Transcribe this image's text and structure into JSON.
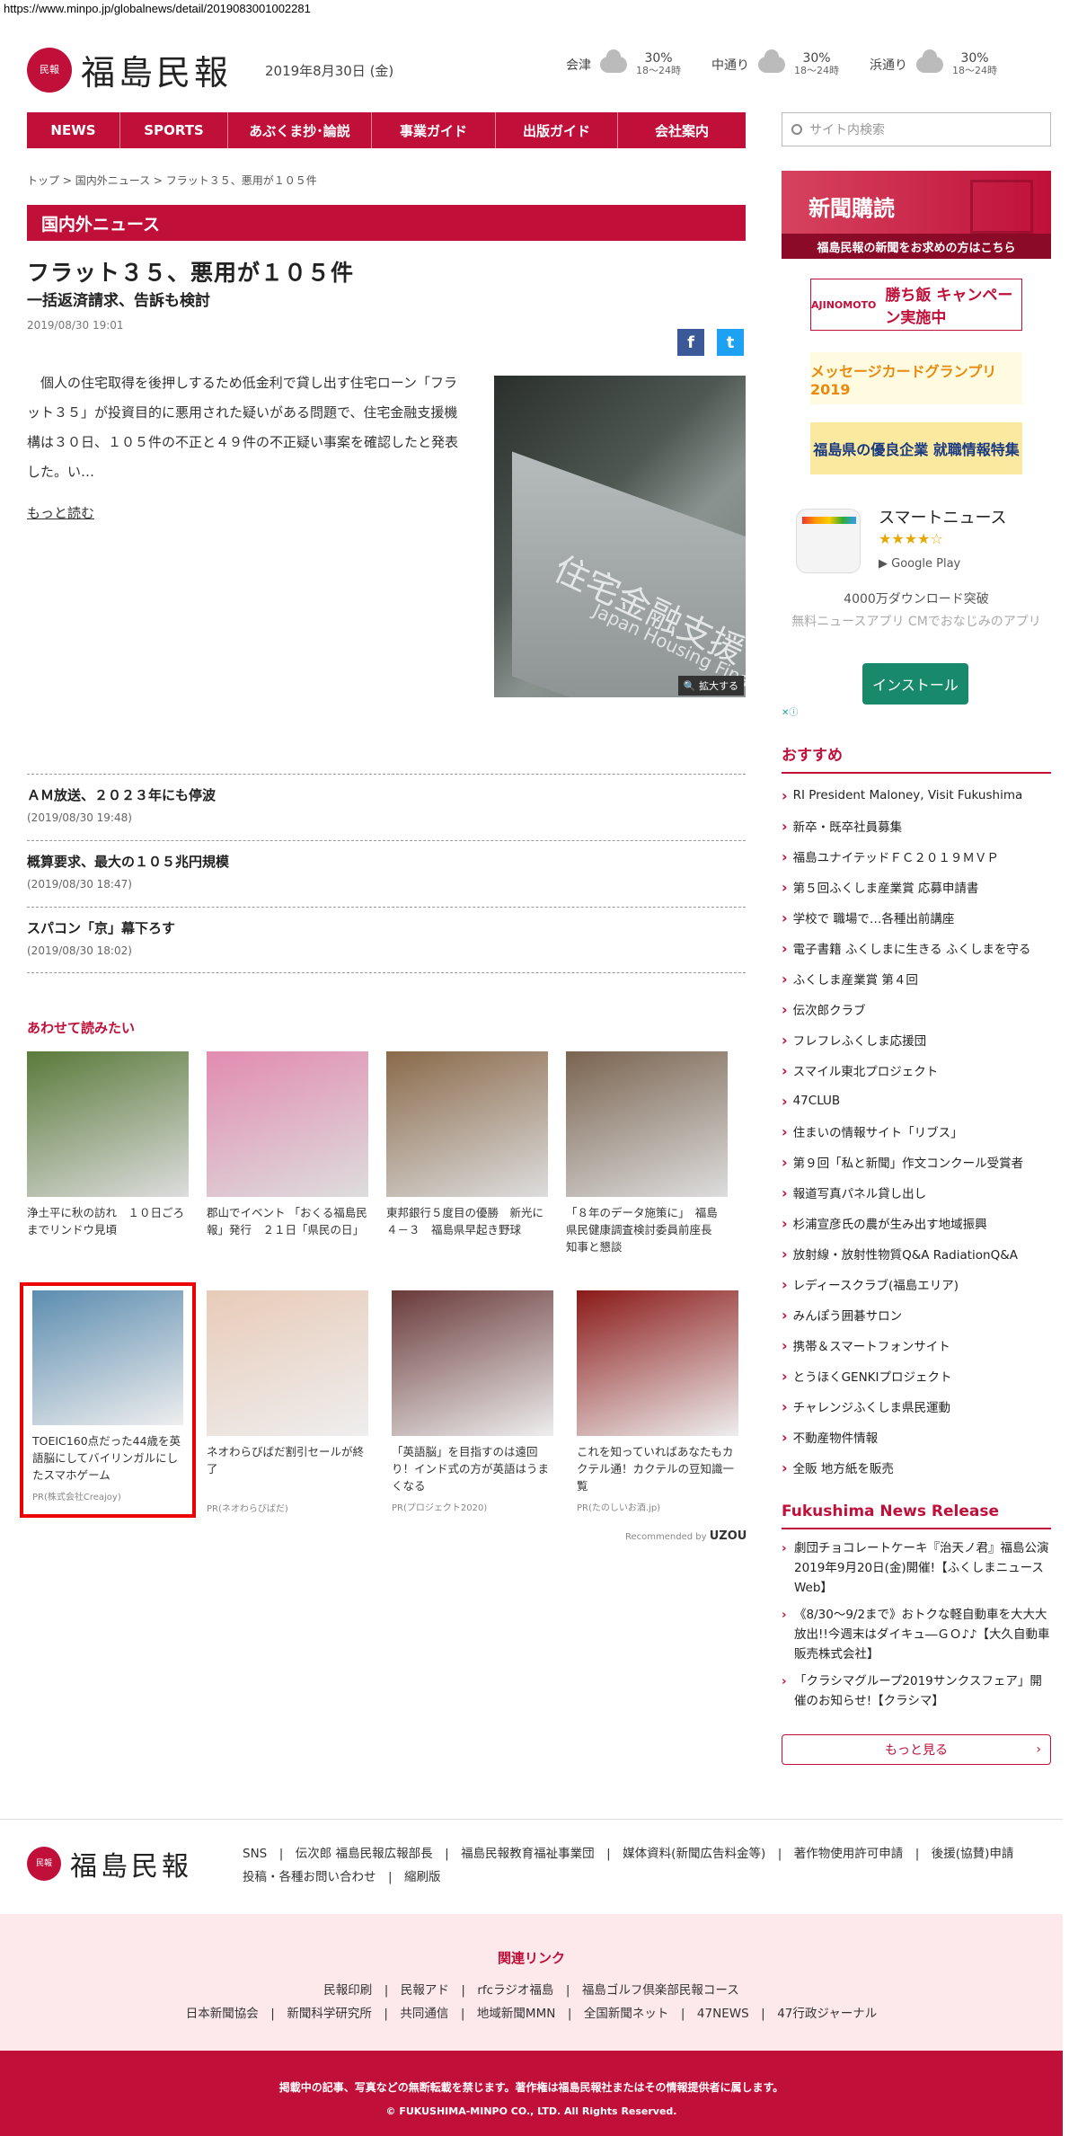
{
  "url": "https://www.minpo.jp/globalnews/detail/2019083001002281",
  "logo": {
    "seal": "民報",
    "name": "福島民報"
  },
  "date": "2019年8月30日 (金)",
  "weather": [
    {
      "area": "会津",
      "pct": "30%",
      "time": "18～24時"
    },
    {
      "area": "中通り",
      "pct": "30%",
      "time": "18～24時"
    },
    {
      "area": "浜通り",
      "pct": "30%",
      "time": "18～24時"
    }
  ],
  "nav": [
    "NEWS",
    "SPORTS",
    "あぶくま抄･論説",
    "事業ガイド",
    "出版ガイド",
    "会社案内"
  ],
  "search_placeholder": "サイト内検索",
  "breadcrumb": [
    "トップ",
    "国内外ニュース",
    "フラット３５、悪用が１０５件"
  ],
  "section_title": "国内外ニュース",
  "article": {
    "title": "フラット３５、悪用が１０５件",
    "subtitle": "一括返済請求、告訴も検討",
    "datetime": "2019/08/30 19:01",
    "body": "　個人の住宅取得を後押しするため低金利で貸し出す住宅ローン「フラット３５」が投資目的に悪用された疑いがある問題で、住宅金融支援機構は３０日、１０５件の不正と４９件の不正疑い事案を確認したと発表した。い…",
    "more": "もっと読む",
    "photo_text": "住宅金融支援",
    "photo_text2": "Japan Housing Finance A",
    "zoom": "拡大する"
  },
  "related_list": [
    {
      "title": "ＡＭ放送、２０２３年にも停波",
      "date": "(2019/08/30 19:48)"
    },
    {
      "title": "概算要求、最大の１０５兆円規模",
      "date": "(2019/08/30 18:47)"
    },
    {
      "title": "スパコン「京」幕下ろす",
      "date": "(2019/08/30 18:02)"
    }
  ],
  "read_together": "あわせて読みたい",
  "thumbs_row1": [
    {
      "cap": "浄土平に秋の訪れ　１０日ごろまでリンドウ見頃",
      "color": "#5a7a3a"
    },
    {
      "cap": "郡山でイベント 「おくる福島民報」発行　２１日「県民の日」",
      "color": "#e28bb0"
    },
    {
      "cap": "東邦銀行５度目の優勝　新光に４－３　福島県早起き野球",
      "color": "#8a6a4a"
    },
    {
      "cap": "「８年のデータ施策に」　福島県民健康調査検討委員前座長　知事と懇談",
      "color": "#7a6450"
    }
  ],
  "thumbs_row2": [
    {
      "cap": "TOEIC160点だった44歳を英語脳にしてバイリンガルにしたスマホゲーム",
      "pr": "PR(株式会社Creajoy)",
      "color": "#5c8db0"
    },
    {
      "cap": "ネオわらびばだ割引セールが終了",
      "pr": "PR(ネオわらびばだ)",
      "color": "#e8cbb8"
    },
    {
      "cap": "「英語脳」を目指すのは遠回り！インド式の方が英語はうまくなる",
      "pr": "PR(プロジェクト2020)",
      "color": "#6a3a3a"
    },
    {
      "cap": "これを知っていればあなたもカクテル通！カクテルの豆知識一覧",
      "pr": "PR(たのしいお酒.jp)",
      "color": "#8a1a18"
    }
  ],
  "recommended_by": "Recommended by",
  "uzou": "UZOU",
  "side": {
    "subscribe_title": "新聞購読",
    "subscribe_sub": "福島民報の新聞をお求めの方はこちら",
    "banner1": "勝ち飯 キャンペーン実施中",
    "banner1_brand": "AJINOMOTO",
    "banner2": "メッセージカードグランプリ 2019",
    "banner3": "福島県の優良企業 就職情報特集",
    "app_name": "スマートニュース",
    "stars": "★★★★☆",
    "gplay": "Google Play",
    "downloads": "4000万ダウンロード突破",
    "desc": "無料ニュースアプリ CMでおなじみのアプリ",
    "install": "インストール",
    "recommend_title": "おすすめ",
    "recommend": [
      "RI President Maloney, Visit Fukushima",
      "新卒・既卒社員募集",
      "福島ユナイテッドＦＣ２０１９ＭＶＰ",
      "第５回ふくしま産業賞 応募申請書",
      "学校で 職場で…各種出前講座",
      "電子書籍 ふくしまに生きる ふくしまを守る",
      "ふくしま産業賞 第４回",
      "伝次郎クラブ",
      "フレフレふくしま応援団",
      "スマイル東北プロジェクト",
      "47CLUB",
      "住まいの情報サイト「リブス」",
      "第９回「私と新聞」作文コンクール受賞者",
      "報道写真パネル貸し出し",
      "杉浦宣彦氏の農が生み出す地域振興",
      "放射線・放射性物質Q&A RadiationQ&A",
      "レディースクラブ(福島エリア)",
      "みんぽう囲碁サロン",
      "携帯＆スマートフォンサイト",
      "とうほくGENKIプロジェクト",
      "チャレンジふくしま県民運動",
      "不動産物件情報",
      "全販 地方紙を販売"
    ],
    "release_title": "Fukushima News Release",
    "release": [
      "劇団チョコレートケーキ『治天ノ君』福島公演 2019年9月20日(金)開催!【ふくしまニュースWeb】",
      "《8/30～9/2まで》おトクな軽自動車を大大大放出!!今週末はダイキュ―ＧＯ♪♪【大久自動車販売株式会社】",
      "「クラシマグループ2019サンクスフェア」開催のお知らせ!【クラシマ】"
    ],
    "more_btn": "もっと見る"
  },
  "footer": {
    "links1": "SNS　|　伝次郎 福島民報広報部長　|　福島民報教育福祉事業団　|　媒体資料(新聞広告料金等)　|　著作物使用許可申請　|　後援(協賛)申請",
    "links2": "投稿・各種お問い合わせ　|　縮刷版",
    "rel_title": "関連リンク",
    "rel1": "民報印刷　|　民報アド　|　rfcラジオ福島　|　福島ゴルフ倶楽部民報コース",
    "rel2": "日本新聞協会　|　新聞科学研究所　|　共同通信　|　地域新聞MMN　|　全国新聞ネット　|　47NEWS　|　47行政ジャーナル",
    "notice": "掲載中の記事、写真などの無断転載を禁じます。著作権は福島民報社またはその情報提供者に属します。",
    "copyright": "© FUKUSHIMA-MINPO CO., LTD. All Rights Reserved."
  }
}
